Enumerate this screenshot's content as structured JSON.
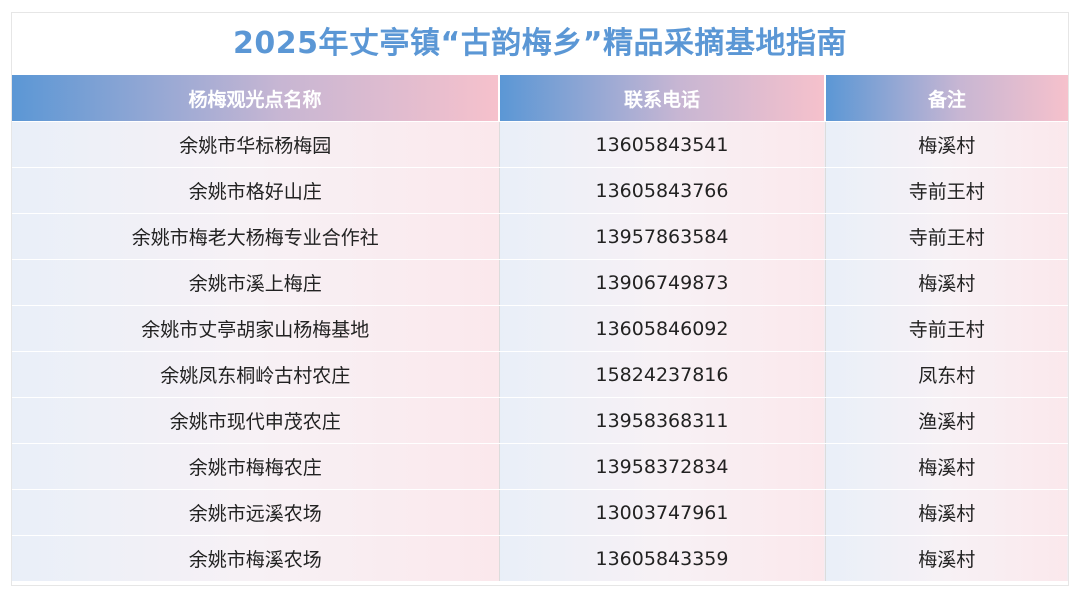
{
  "title": "2025年丈亭镇“古韵梅乡”精品采摘基地指南",
  "headers": {
    "name": "杨梅观光点名称",
    "phone": "联系电话",
    "note": "备注"
  },
  "rows": [
    {
      "name": "余姚市华标杨梅园",
      "phone": "13605843541",
      "note": "梅溪村"
    },
    {
      "name": "余姚市格好山庄",
      "phone": "13605843766",
      "note": "寺前王村"
    },
    {
      "name": "余姚市梅老大杨梅专业合作社",
      "phone": "13957863584",
      "note": "寺前王村"
    },
    {
      "name": "余姚市溪上梅庄",
      "phone": "13906749873",
      "note": "梅溪村"
    },
    {
      "name": "余姚市丈亭胡家山杨梅基地",
      "phone": "13605846092",
      "note": "寺前王村"
    },
    {
      "name": "余姚凤东桐岭古村农庄",
      "phone": "15824237816",
      "note": "凤东村"
    },
    {
      "name": "余姚市现代申茂农庄",
      "phone": "13958368311",
      "note": "渔溪村"
    },
    {
      "name": "余姚市梅梅农庄",
      "phone": "13958372834",
      "note": "梅溪村"
    },
    {
      "name": "余姚市远溪农场",
      "phone": "13003747961",
      "note": "梅溪村"
    },
    {
      "name": "余姚市梅溪农场",
      "phone": "13605843359",
      "note": "梅溪村"
    }
  ],
  "colors": {
    "title": "#5b97d5",
    "header_start": "#5b97d5",
    "header_end": "#f6c1cc"
  }
}
